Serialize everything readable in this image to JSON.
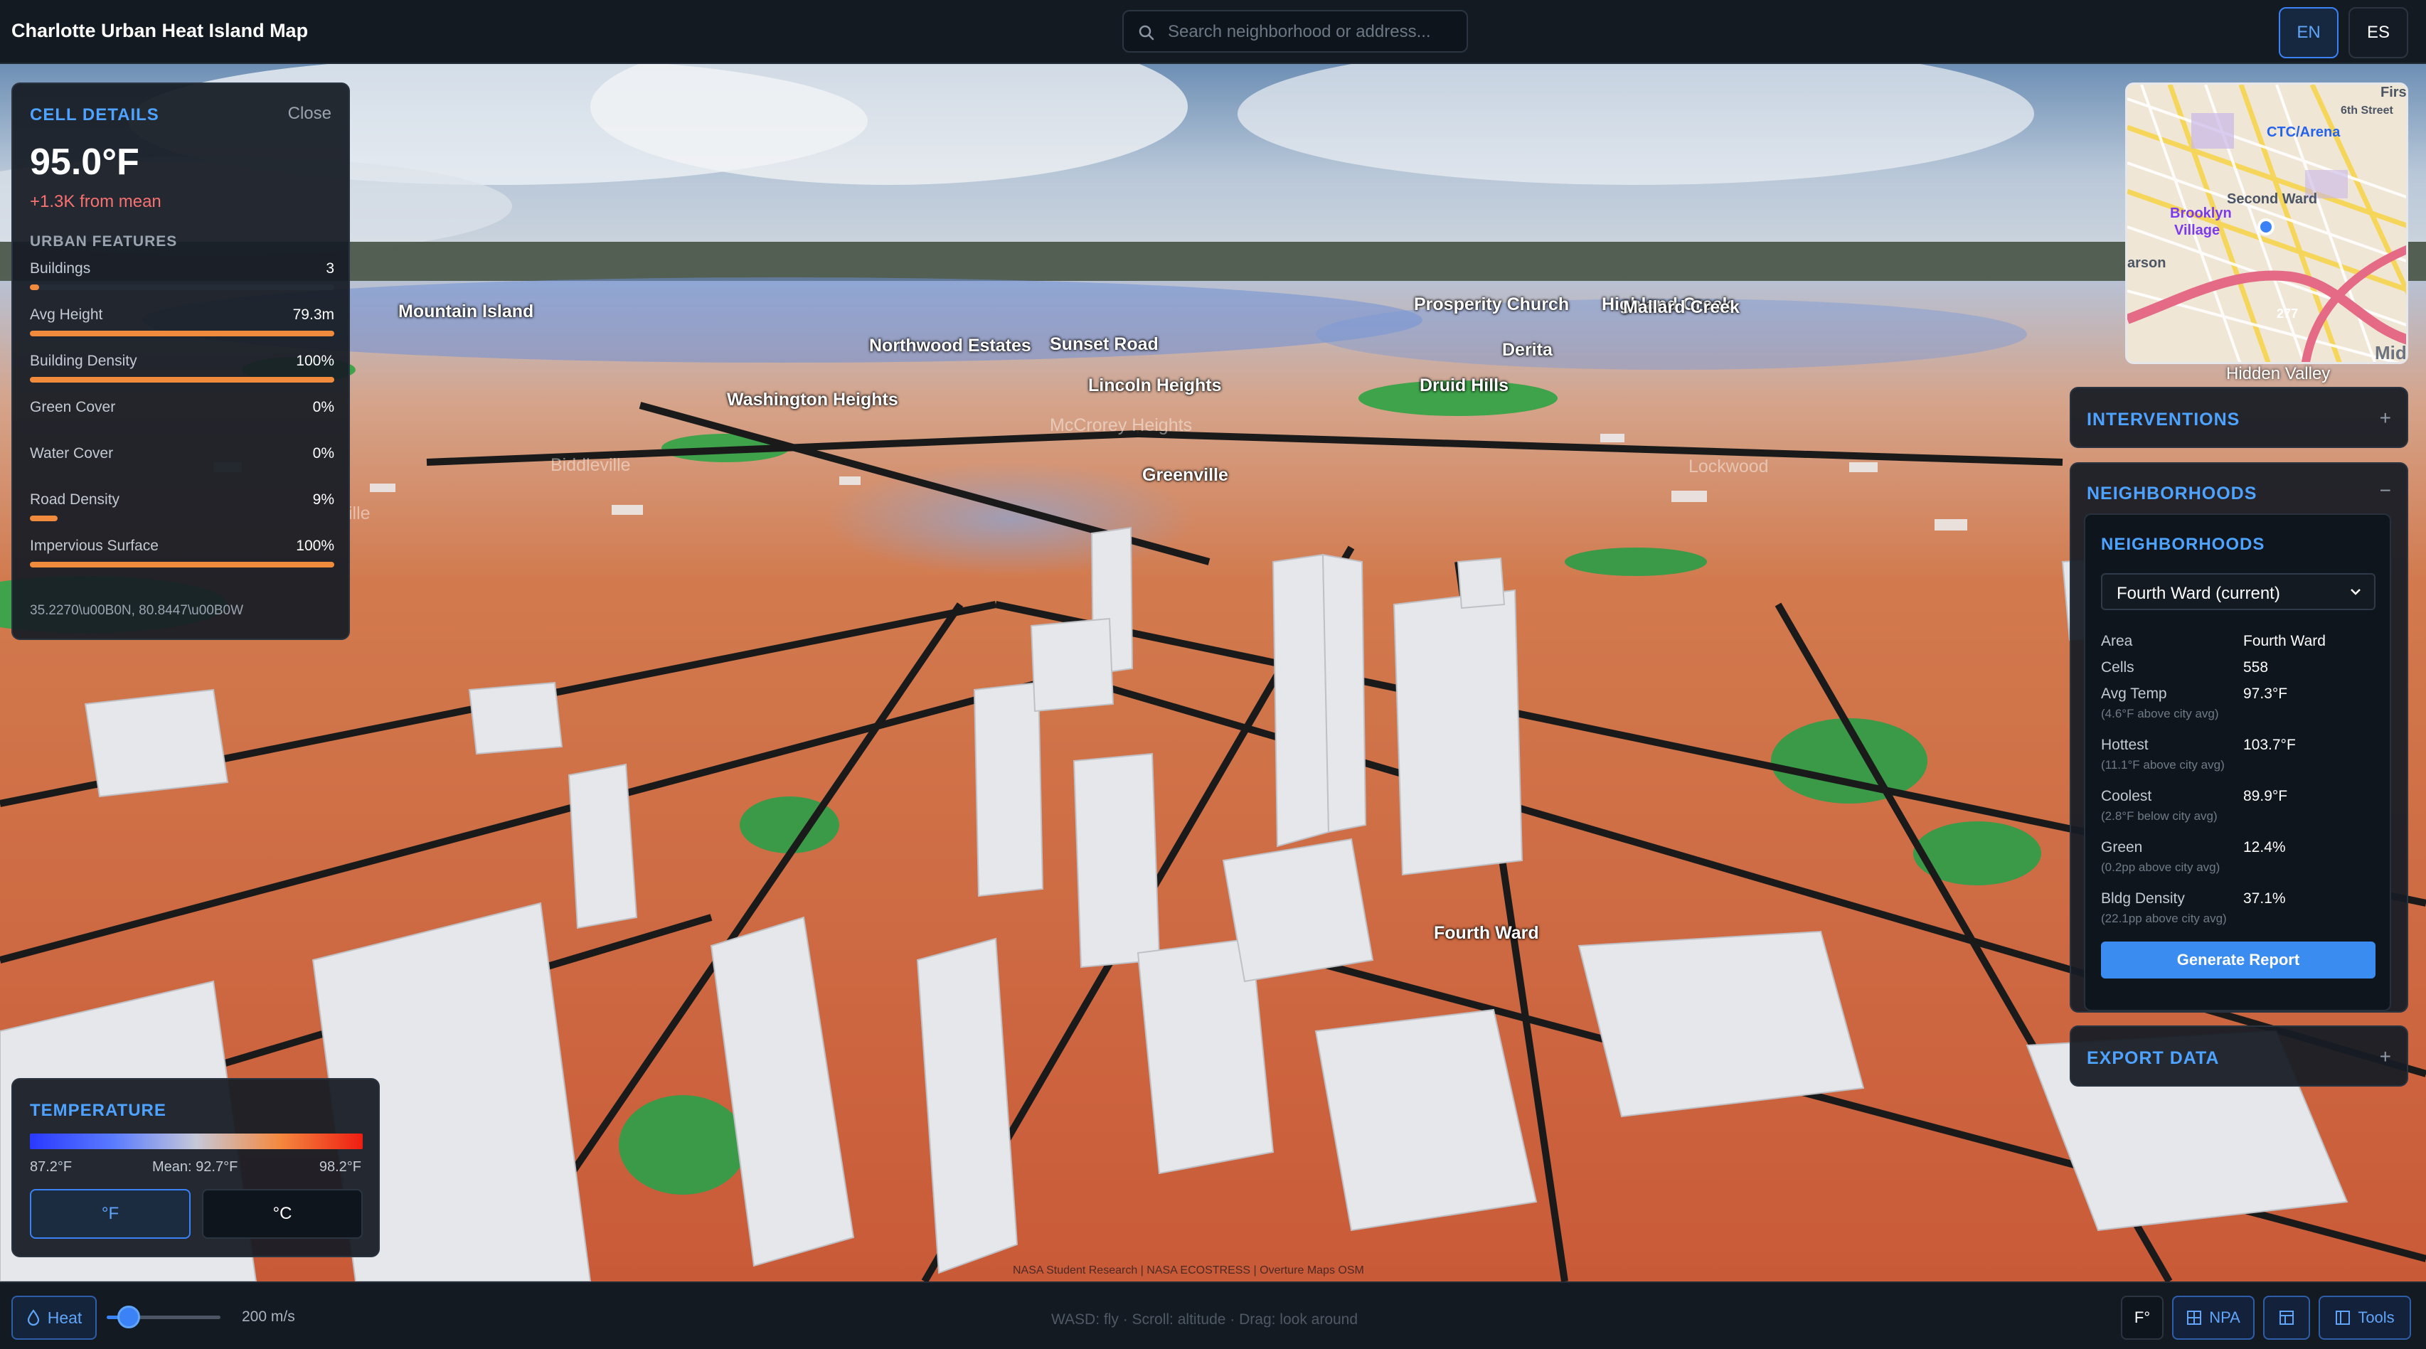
{
  "app": {
    "title": "Charlotte Urban Heat Island Map"
  },
  "search": {
    "placeholder": "Search neighborhood or address..."
  },
  "language": {
    "options": [
      "EN",
      "ES"
    ],
    "active": "EN"
  },
  "cell_details": {
    "heading": "CELL DETAILS",
    "close_label": "Close",
    "temperature": "95.0°F",
    "delta": "+1.3K from mean",
    "features_heading": "URBAN FEATURES",
    "features": [
      {
        "label": "Buildings",
        "value": "3",
        "fraction": 0.03
      },
      {
        "label": "Avg Height",
        "value": "79.3m",
        "fraction": 1.0
      },
      {
        "label": "Building Density",
        "value": "100%",
        "fraction": 1.0
      },
      {
        "label": "Green Cover",
        "value": "0%",
        "fraction": 0
      },
      {
        "label": "Water Cover",
        "value": "0%",
        "fraction": 0
      },
      {
        "label": "Road Density",
        "value": "9%",
        "fraction": 0.09
      },
      {
        "label": "Impervious Surface",
        "value": "100%",
        "fraction": 1.0
      }
    ],
    "coordinates": "35.2270\\u00B0N, 80.8447\\u00B0W"
  },
  "temperature_legend": {
    "heading": "TEMPERATURE",
    "min": "87.2°F",
    "mean": "Mean: 92.7°F",
    "max": "98.2°F",
    "units": [
      "°F",
      "°C"
    ],
    "active_unit": "°F",
    "colors": [
      "#2a39ff",
      "#5a7bff",
      "#c6c8d8",
      "#f4893f",
      "#ef1d12"
    ]
  },
  "map_labels": {
    "mountain_island": "Mountain Island",
    "northwood_estates": "Northwood Estates",
    "sunset_road": "Sunset Road",
    "prosperity_church": "Prosperity Church",
    "highland_creek": "Highland Creek",
    "mallard_creek": "Mallard Creek",
    "derita": "Derita",
    "lincoln_heights": "Lincoln Heights",
    "druid_hills": "Druid Hills",
    "washington_heights": "Washington Heights",
    "mccrorey_heights": "McCrorey Heights",
    "biddleville": "Biddleville",
    "greenville": "Greenville",
    "lockwood": "Lockwood",
    "fourth_ward": "Fourth Ward",
    "ille": "ille"
  },
  "attribution": "NASA Student Research | NASA ECOSTRESS | Overture Maps OSM",
  "minimap": {
    "labels": {
      "ctc_arena": "CTC/Arena",
      "second_ward": "Second Ward",
      "brooklyn": "Brooklyn",
      "village": "Village",
      "first": "First",
      "sixth_street": "6th Street",
      "midt": "Midt",
      "arson": "arson",
      "i277": "277"
    },
    "hidden_valley": "Hidden Valley"
  },
  "sections": {
    "interventions": {
      "title": "INTERVENTIONS",
      "toggle": "+"
    },
    "neighborhoods": {
      "title": "NEIGHBORHOODS",
      "toggle": "−"
    },
    "export": {
      "title": "EXPORT DATA",
      "toggle": "+"
    }
  },
  "neighborhood_panel": {
    "heading": "NEIGHBORHOODS",
    "selected": "Fourth Ward (current)",
    "stats": [
      {
        "label": "Area",
        "value": "Fourth Ward",
        "note": ""
      },
      {
        "label": "Cells",
        "value": "558",
        "note": ""
      },
      {
        "label": "Avg Temp",
        "value": "97.3°F",
        "note": "(4.6°F above city avg)"
      },
      {
        "label": "Hottest",
        "value": "103.7°F",
        "note": "(11.1°F above city avg)"
      },
      {
        "label": "Coolest",
        "value": "89.9°F",
        "note": "(2.8°F below city avg)"
      },
      {
        "label": "Green",
        "value": "12.4%",
        "note": "(0.2pp above city avg)"
      },
      {
        "label": "Bldg Density",
        "value": "37.1%",
        "note": "(22.1pp above city avg)"
      }
    ],
    "report_button": "Generate Report"
  },
  "bottom_bar": {
    "heat_label": "Heat",
    "speed": "200 m/s",
    "speed_fraction": 0.12,
    "hint": "WASD: fly · Scroll: altitude · Drag: look around",
    "unit_toggle": "F°",
    "npa_label": "NPA",
    "tools_label": "Tools"
  }
}
